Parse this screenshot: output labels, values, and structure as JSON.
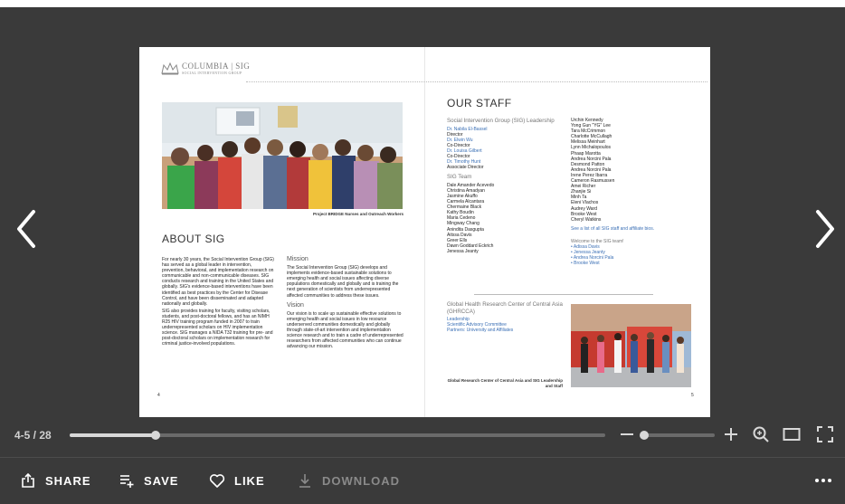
{
  "viewer": {
    "page_indicator": "4-5 / 28",
    "progress_fraction": 0.16,
    "zoom_fraction": 0.05
  },
  "document": {
    "logo_main": "COLUMBIA | SIG",
    "logo_sub": "SOCIAL INTERVENTION GROUP",
    "left_page": {
      "photo_caption": "Project BRIDGE Nurses and Outreach Workers",
      "about_title": "ABOUT SIG",
      "about_p1": "For nearly 30 years, the Social Intervention Group (SIG) has served as a global leader in intervention, prevention, behavioral, and implementation research on communicable and non-communicable diseases. SIG conducts research and training in the United States and globally. SIG's evidence-based interventions have been identified as best practices by the Center for Disease Control, and have been disseminated and adapted nationally and globally.",
      "about_p2": "SIG also provides training for faculty, visiting scholars, students, and post-doctoral fellows, and has an NIMH R25 HIV training program funded in 2007 to train underrepresented scholars on HIV implementation science. SIG manages a NIDA T32 training for pre- and post-doctoral scholars on implementation research for criminal justice-involved populations.",
      "mission_title": "Mission",
      "mission_text": "The Social Intervention Group (SIG) develops and implements evidence-based sustainable solutions to emerging health and social issues affecting diverse populations domestically and globally and is training the next generation of scientists from underrepresented affected communities to address these issues.",
      "vision_title": "Vision",
      "vision_text": "Our vision is to scale up sustainable effective solutions to emerging health and social issues in low resource underserved communities domestically and globally through state-of-art intervention and implementation science research and to train a cadre of underrepresented researchers from affected communities who can continue advancing our mission.",
      "page_number": "4"
    },
    "right_page": {
      "staff_title": "OUR STAFF",
      "leadership_heading": "Social Intervention Group (SIG) Leadership",
      "leaders": [
        {
          "name": "Dr. Nabila El-Bassel",
          "role": "Director"
        },
        {
          "name": "Dr. Elwin Wu",
          "role": "Co-Director"
        },
        {
          "name": "Dr. Louisa Gilbert",
          "role": "Co-Director"
        },
        {
          "name": "Dr. Timothy Hunt",
          "role": "Associate Director"
        }
      ],
      "team_heading": "SIG Team",
      "team_col1": [
        "Dale Amander Acevedo",
        "Christina Amadyan",
        "Jasmine Akuffo",
        "Carmela Alcantara",
        "Chermaine Black",
        "Kathy Boudin",
        "Maria Cedeno",
        "Mingway Chang",
        "Anindita Dasgupta",
        "Aitssa Davis",
        "Greer Ells",
        "Dawn Goddard Eckrich",
        "Jenessa Jeanty"
      ],
      "team_col2": [
        "Urchin Kennedy",
        "Yong Gun \"YG\" Lee",
        "Tara McCrimmon",
        "Charlotte McCullagh",
        "Melissa Meinhart",
        "Lynn Michalopoulos",
        "Phaap Marotta",
        "Andrea Norcini Pala",
        "Desmond Patton",
        "Andrea Norcini Pala",
        "Irene Perez Ibarra",
        "Cameron Rasmussen",
        "Amei Richer",
        "Zhanjie Si",
        "Minh Ta",
        "Eleni Vlachos",
        "Audrey Ward",
        "Brooke West",
        "Cheryl Watkins"
      ],
      "see_list": "See a list of all SIG staff and affiliate bios.",
      "welcome_heading": "Welcome to the SIG team!",
      "welcome_list": [
        "Adissa Davis",
        "Jenessa Jeanty",
        "Andrea Norcini Pala",
        "Brooke West"
      ],
      "ghrcca_heading": "Global Health Research Center of Central Asia (GHRCCA)",
      "ghrcca_links": [
        "Leadership",
        "Scientific Advisory Committee",
        "Partners: University and Affiliates"
      ],
      "photo_caption": "Global Research Center of Central Asia and SIG Leadership and Staff",
      "page_number": "5"
    }
  },
  "actions": {
    "share": "SHARE",
    "save": "SAVE",
    "like": "LIKE",
    "download": "DOWNLOAD"
  },
  "colors": {
    "background": "#3a3a3a",
    "link_blue": "#3a6fb5"
  }
}
